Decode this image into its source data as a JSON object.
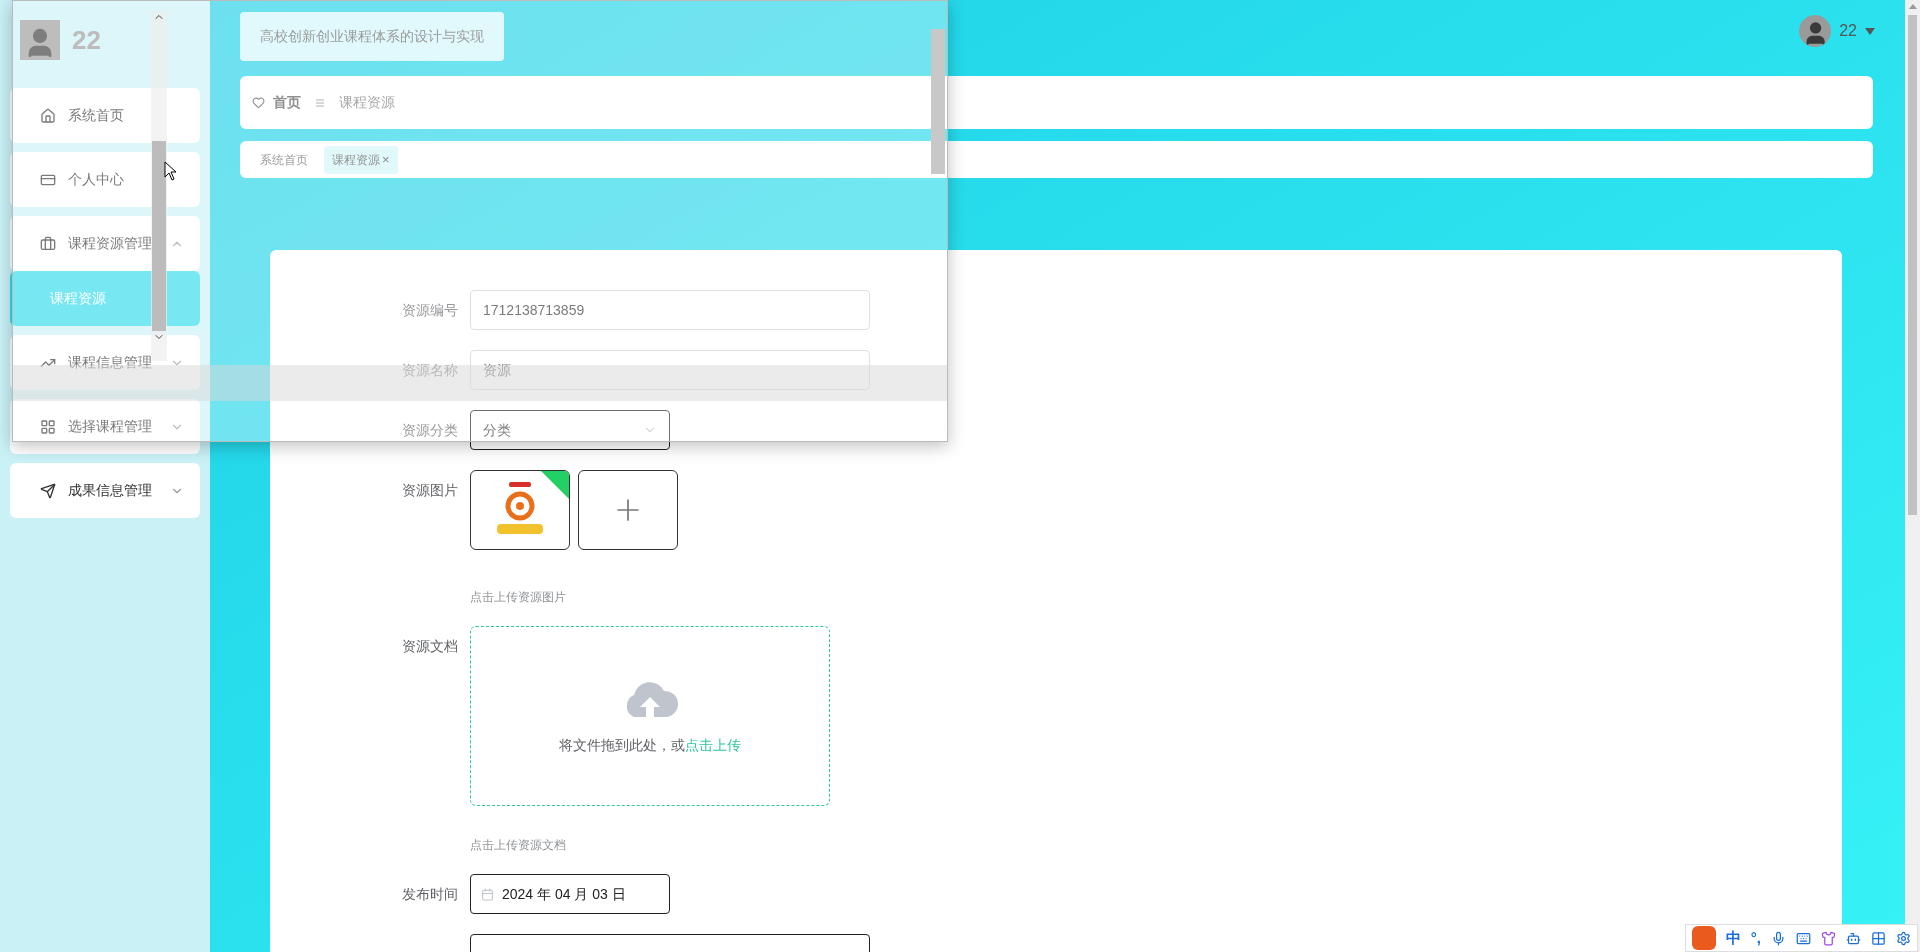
{
  "app": {
    "title": "高校创新创业课程体系的设计与实现"
  },
  "user": {
    "name": "22"
  },
  "sidebar": {
    "user": "22",
    "items": [
      {
        "kind": "link",
        "label": "系统首页"
      },
      {
        "kind": "link",
        "label": "个人中心"
      },
      {
        "kind": "group",
        "label": "课程资源管理",
        "expanded": true,
        "children": [
          {
            "label": "课程资源",
            "selected": true
          }
        ]
      },
      {
        "kind": "group",
        "label": "课程信息管理",
        "expanded": false
      },
      {
        "kind": "group",
        "label": "选择课程管理",
        "expanded": false
      },
      {
        "kind": "group",
        "label": "成果信息管理",
        "expanded": false
      }
    ]
  },
  "breadcrumb": {
    "home": "首页",
    "current": "课程资源"
  },
  "tags": [
    {
      "label": "系统首页",
      "selected": false
    },
    {
      "label": "课程资源",
      "selected": true,
      "close": "×"
    }
  ],
  "form": {
    "fields": [
      {
        "kind": "text",
        "label": "资源编号",
        "value": "1712138713859"
      },
      {
        "kind": "text",
        "label": "资源名称",
        "value": "资源"
      },
      {
        "kind": "select",
        "label": "资源分类",
        "value": "分类"
      },
      {
        "kind": "image-upload",
        "label": "资源图片",
        "hint": "点击上传资源图片"
      },
      {
        "kind": "file-upload",
        "label": "资源文档",
        "text": "将文件拖到此处，或",
        "link": "点击上传",
        "hint": "点击上传资源文档"
      },
      {
        "kind": "date",
        "label": "发布时间",
        "value": "2024 年 04 月 03 日"
      },
      {
        "kind": "cutoff"
      }
    ]
  },
  "ime": {
    "items": [
      "中",
      "°,"
    ]
  }
}
